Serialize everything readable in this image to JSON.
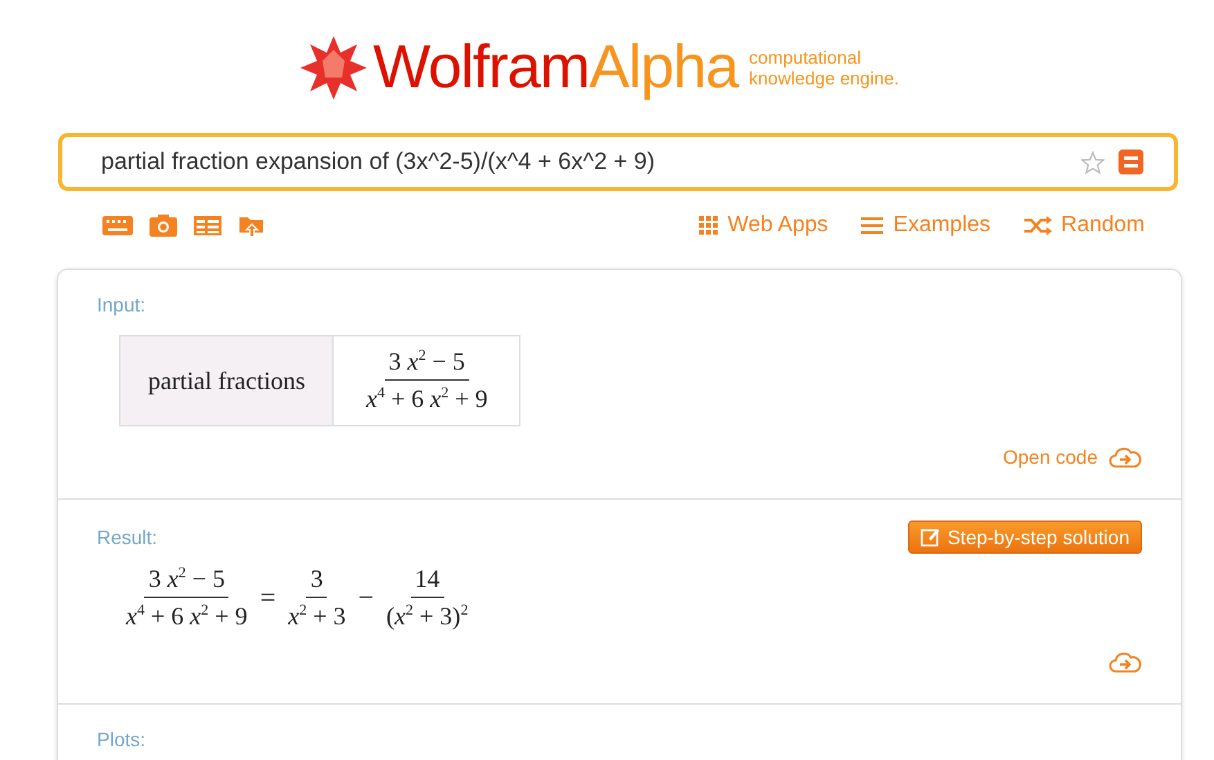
{
  "logo": {
    "brand_first": "Wolfram",
    "brand_second": "Alpha",
    "tagline": [
      "computational",
      "knowledge engine."
    ]
  },
  "search": {
    "value": "partial fraction expansion of (3x^2-5)/(x^4 + 6x^2 + 9)"
  },
  "tools": [
    {
      "kind": "keyboard"
    },
    {
      "kind": "camera"
    },
    {
      "kind": "table"
    },
    {
      "kind": "folder"
    }
  ],
  "nav_links": [
    {
      "kind": "grid",
      "label": "Web Apps"
    },
    {
      "kind": "lines",
      "label": "Examples"
    },
    {
      "kind": "shuffle",
      "label": "Random"
    }
  ],
  "pods": [
    {
      "title": "Input:",
      "table": {
        "label": "partial fractions",
        "numerator": "3 *x*$^{2}$ − 5",
        "denominator": "*x*$^{4}$ + 6 *x*$^{2}$ + 9"
      },
      "link": "Open code"
    },
    {
      "title": "Result:",
      "button": "Step-by-step solution",
      "equation": [
        {
          "kind": "fraction",
          "numerator": "3 *x*$^{2}$ − 5",
          "denominator": "*x*$^{4}$ + 6 *x*$^{2}$ + 9"
        },
        {
          "kind": "operator",
          "text": "="
        },
        {
          "kind": "fraction",
          "numerator": "3",
          "denominator": "*x*$^{2}$ + 3"
        },
        {
          "kind": "operator",
          "text": "−"
        },
        {
          "kind": "fraction",
          "numerator": "14",
          "denominator": "(*x*$^{2}$ + 3)$^{2}$"
        }
      ],
      "cloud": true
    },
    {
      "title": "Plots:"
    }
  ]
}
